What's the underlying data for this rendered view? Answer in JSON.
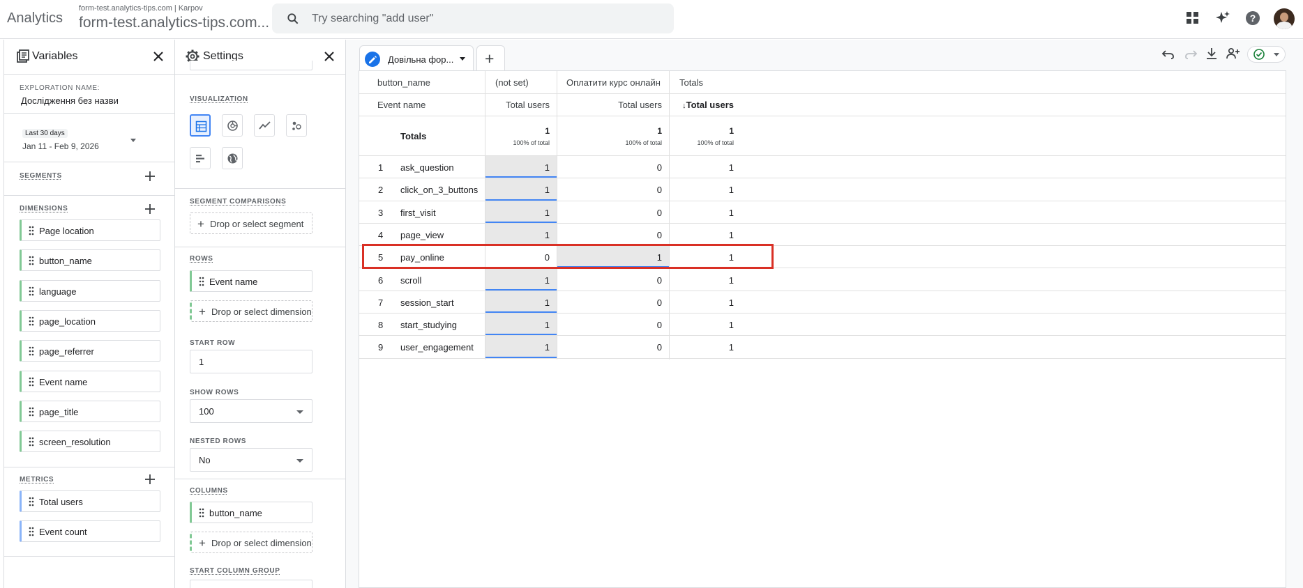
{
  "header": {
    "app_title": "Analytics",
    "account_small": "form-test.analytics-tips.com | Karpov",
    "account_big": "form-test.analytics-tips.com...",
    "search_placeholder": "Try searching \"add user\""
  },
  "variables_panel": {
    "title": "Variables",
    "exploration_name_label": "EXPLORATION NAME:",
    "exploration_name": "Дослідження без назви",
    "date_chip": "Last 30 days",
    "date_range": "Jan 11 - Feb 9, 2026",
    "segments_label": "SEGMENTS",
    "dimensions_label": "DIMENSIONS",
    "dimensions": [
      "Page location",
      "button_name",
      "language",
      "page_location",
      "page_referrer",
      "Event name",
      "page_title",
      "screen_resolution"
    ],
    "metrics_label": "METRICS",
    "metrics": [
      "Total users",
      "Event count"
    ]
  },
  "settings_panel": {
    "title": "Settings",
    "visualization_label": "VISUALIZATION",
    "segment_comparisons_label": "SEGMENT COMPARISONS",
    "drop_segment": "Drop or select segment",
    "rows_label": "ROWS",
    "row_dimension": "Event name",
    "drop_dimension": "Drop or select dimension",
    "start_row_label": "START ROW",
    "start_row": "1",
    "show_rows_label": "SHOW ROWS",
    "show_rows": "100",
    "nested_rows_label": "NESTED ROWS",
    "nested_rows": "No",
    "columns_label": "COLUMNS",
    "column_dimension": "button_name",
    "drop_dimension_2": "Drop or select dimension",
    "start_column_group_label": "START COLUMN GROUP"
  },
  "tab": {
    "label": "Довільна фор..."
  },
  "table": {
    "col_dimension_header": "button_name",
    "row_dimension_header": "Event name",
    "columns": [
      "(not set)",
      "Оплатити курс онлайн",
      "Totals"
    ],
    "metric_headers": [
      "Total users",
      "Total users",
      "Total users"
    ],
    "sorted_metric_header": "Total users",
    "totals_label": "Totals",
    "totals": [
      "1",
      "1",
      "1"
    ],
    "totals_pct": [
      "100% of total",
      "100% of total",
      "100% of total"
    ],
    "rows": [
      {
        "idx": "1",
        "name": "ask_question",
        "v": [
          "1",
          "0",
          "1"
        ]
      },
      {
        "idx": "2",
        "name": "click_on_3_buttons",
        "v": [
          "1",
          "0",
          "1"
        ]
      },
      {
        "idx": "3",
        "name": "first_visit",
        "v": [
          "1",
          "0",
          "1"
        ]
      },
      {
        "idx": "4",
        "name": "page_view",
        "v": [
          "1",
          "0",
          "1"
        ]
      },
      {
        "idx": "5",
        "name": "pay_online",
        "v": [
          "0",
          "1",
          "1"
        ]
      },
      {
        "idx": "6",
        "name": "scroll",
        "v": [
          "1",
          "0",
          "1"
        ]
      },
      {
        "idx": "7",
        "name": "session_start",
        "v": [
          "1",
          "0",
          "1"
        ]
      },
      {
        "idx": "8",
        "name": "start_studying",
        "v": [
          "1",
          "0",
          "1"
        ]
      },
      {
        "idx": "9",
        "name": "user_engagement",
        "v": [
          "1",
          "0",
          "1"
        ]
      }
    ],
    "highlighted_row": "5"
  },
  "colors": {
    "dimension_accent": "#81c995",
    "metric_accent": "#8ab4f8",
    "heat_bar": "#4285f4",
    "highlight_box": "#d93025"
  }
}
